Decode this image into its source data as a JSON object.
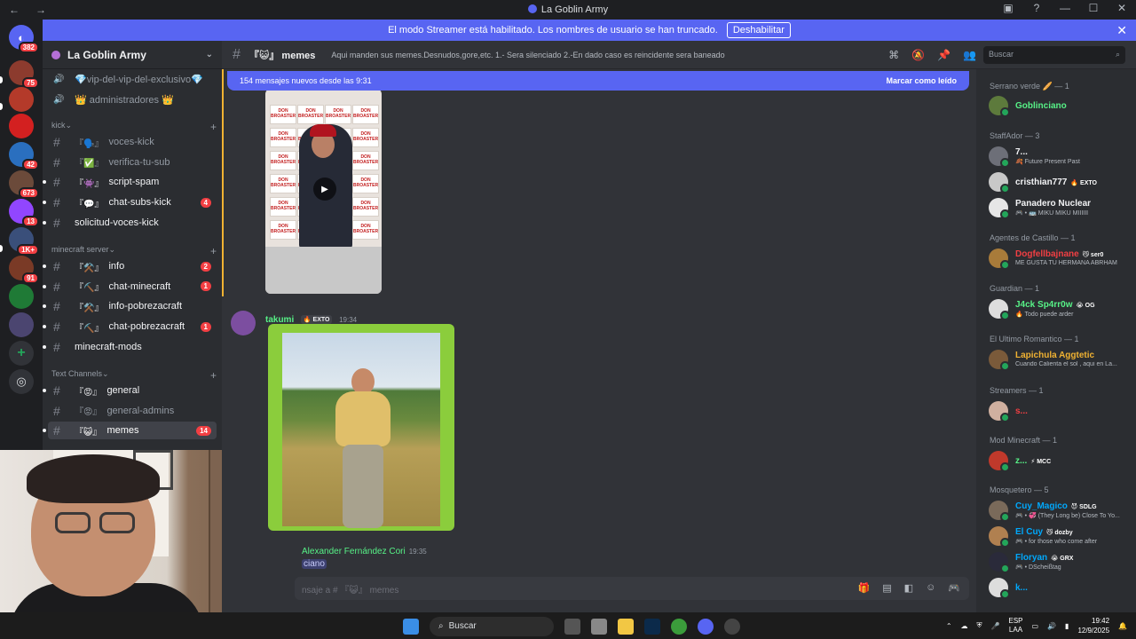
{
  "window": {
    "title": "La Goblin Army",
    "nav_back": "←",
    "nav_fwd": "→"
  },
  "streamer_banner": {
    "text": "El modo Streamer está habilitado. Los nombres de usuario se han truncado.",
    "button": "Deshabilitar"
  },
  "server_rail": [
    {
      "badge": "382",
      "color": "#5865f2",
      "icon": "discord-logo"
    },
    {
      "badge": "75",
      "color": "#8c3b2e"
    },
    {
      "badge": "",
      "color": "#b43a2a"
    },
    {
      "badge": "",
      "color": "#d32020"
    },
    {
      "badge": "42",
      "color": "#2a6fbf"
    },
    {
      "badge": "673",
      "color": "#6b4a3a"
    },
    {
      "badge": "13",
      "color": "#9146ff"
    },
    {
      "badge": "1K+",
      "color": "#3a4f7a"
    },
    {
      "badge": "91",
      "color": "#7a3a26"
    },
    {
      "badge": "",
      "color": "#1f7a36"
    },
    {
      "badge": "",
      "color": "#4b4570"
    },
    {
      "badge": "",
      "color": "#313338",
      "icon": "add-server-icon"
    },
    {
      "badge": "",
      "color": "#313338",
      "icon": "explore-icon"
    }
  ],
  "guild": {
    "name": "La Goblin Army"
  },
  "sidebar": {
    "top_channels": [
      {
        "label": "💎vip-del-vip-del-exclusivo💎",
        "icon": "speaker-icon"
      },
      {
        "label": "👑 administradores 👑",
        "icon": "speaker-icon"
      }
    ],
    "categories": [
      {
        "label": "kick"
      },
      {
        "label": "minecraft server"
      },
      {
        "label": "Text Channels"
      }
    ],
    "kick": [
      {
        "emoji": "『🗣️』",
        "label": "voces-kick",
        "count": ""
      },
      {
        "emoji": "『✅』",
        "label": "verifica-tu-sub",
        "count": ""
      },
      {
        "emoji": "『👾』",
        "label": "script-spam",
        "count": ""
      },
      {
        "emoji": "『💬』",
        "label": "chat-subs-kick",
        "count": "4"
      },
      {
        "emoji": "",
        "label": "solicitud-voces-kick",
        "count": ""
      }
    ],
    "minecraft": [
      {
        "emoji": "『⚒️』",
        "label": "info",
        "count": "2"
      },
      {
        "emoji": "『⛏️』",
        "label": "chat-minecraft",
        "count": "1"
      },
      {
        "emoji": "『⚒️』",
        "label": "info-pobrezacraft",
        "count": ""
      },
      {
        "emoji": "『⛏️』",
        "label": "chat-pobrezacraft",
        "count": "1"
      },
      {
        "emoji": "",
        "label": "minecraft-mods",
        "count": ""
      }
    ],
    "text": [
      {
        "emoji": "『😡』",
        "label": "general",
        "count": ""
      },
      {
        "emoji": "『😡』",
        "label": "general-admins",
        "count": ""
      },
      {
        "emoji": "『😺』",
        "label": "memes",
        "count": "14"
      }
    ]
  },
  "channel_header": {
    "name": "『😺』 memes",
    "topic": "Aqui manden sus memes.Desnudos,gore,etc. 1.- Sera silenciado 2.-En dado caso es reincidente sera baneado",
    "search_placeholder": "Buscar"
  },
  "chat": {
    "new_messages_bar": "154 mensajes nuevos desde las 9:31",
    "mark_read": "Marcar como leído",
    "video_tile_text": "DON BROASTER",
    "message": {
      "author": "takumi",
      "tag": "🔥 EXTO",
      "time": "19:34"
    },
    "reply": {
      "author": "Alexander Fernández Cori",
      "time": "19:35",
      "mention": "ciano"
    },
    "composer_placeholder": "nsaje a # 『😺』 memes"
  },
  "members": {
    "groups": [
      {
        "label": "Serrano verde 🥖 — 1"
      },
      {
        "label": "StaffAdor — 3"
      },
      {
        "label": "Agentes de Castillo — 1"
      },
      {
        "label": "Guardian — 1"
      },
      {
        "label": "El Ultimo Romantico — 1"
      },
      {
        "label": "Streamers — 1"
      },
      {
        "label": "Mod Minecraft — 1"
      },
      {
        "label": "Mosquetero — 5"
      }
    ],
    "list": [
      {
        "name": "Goblinciano",
        "color": "#57f287",
        "tag": "",
        "status": ""
      },
      {
        "name": "7...",
        "color": "#f2f3f5",
        "tag": "",
        "status": "🍂 Future Present Past"
      },
      {
        "name": "cristhian777",
        "color": "#f2f3f5",
        "tag": "🔥 EXTO",
        "status": ""
      },
      {
        "name": "Panadero Nuclear",
        "color": "#f2f3f5",
        "tag": "",
        "status": "🎮 • 🚌 MIKU MIKU MIIIIII"
      },
      {
        "name": "Dogfellbajnane",
        "color": "#f23f43",
        "tag": "😼 ser0",
        "status": "ME GUSTA TU HERMANA ABRHAM"
      },
      {
        "name": "J4ck Sp4rr0w",
        "color": "#57f287",
        "tag": "😭 OG",
        "status": "🔥 Todo puede arder"
      },
      {
        "name": "Lapichula Aggtetic",
        "color": "#f0b232",
        "tag": "",
        "status": "Cuando Calienta el sol , aqui en La..."
      },
      {
        "name": "s...",
        "color": "#f23f43",
        "tag": "",
        "status": ""
      },
      {
        "name": "z...",
        "color": "#57f287",
        "tag": "⚡ MCC",
        "status": ""
      },
      {
        "name": "Cuy_Magico",
        "color": "#00a8fc",
        "tag": "😈 SDLG",
        "status": "🎮 • 💞 (They Long be) Close To Yo..."
      },
      {
        "name": "El Cuy",
        "color": "#00a8fc",
        "tag": "😼 dozby",
        "status": "🎮 • for those who come after"
      },
      {
        "name": "Floryan",
        "color": "#00a8fc",
        "tag": "😭 GRX",
        "status": "🎮 • DScheißtag"
      },
      {
        "name": "k...",
        "color": "#00a8fc",
        "tag": "",
        "status": ""
      }
    ]
  },
  "taskbar": {
    "search": "Buscar",
    "lang": "ESP",
    "lang2": "LAA",
    "time": "19:42",
    "date": "12/9/2025"
  }
}
